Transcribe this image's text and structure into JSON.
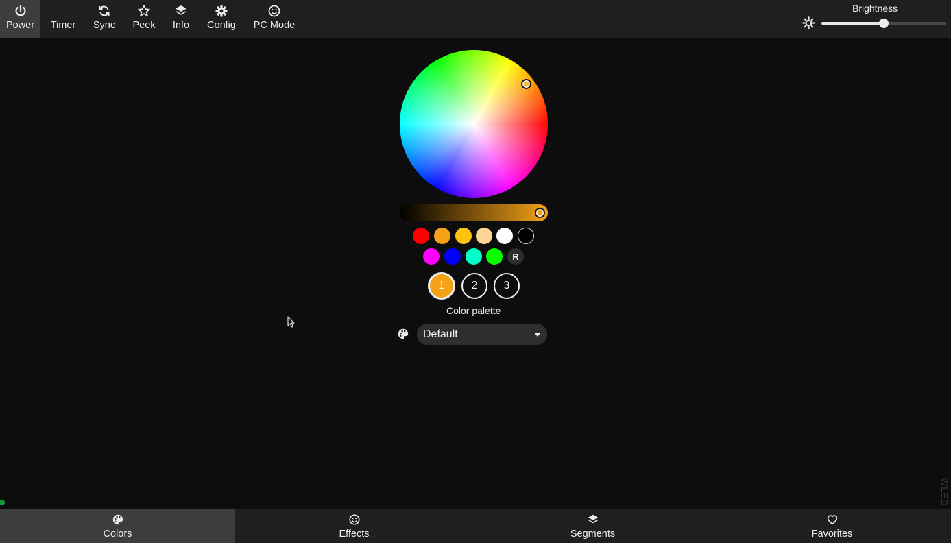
{
  "top_nav": [
    {
      "label": "Power",
      "icon": "power-icon",
      "active": true
    },
    {
      "label": "Timer",
      "icon": "moon-icon"
    },
    {
      "label": "Sync",
      "icon": "sync-icon"
    },
    {
      "label": "Peek",
      "icon": "star-icon"
    },
    {
      "label": "Info",
      "icon": "layers-icon"
    },
    {
      "label": "Config",
      "icon": "gear-icon"
    },
    {
      "label": "PC Mode",
      "icon": "smiley-icon"
    }
  ],
  "brightness": {
    "label": "Brightness",
    "value_fraction": 0.5
  },
  "color_picker": {
    "selected_color": "#f5a218",
    "value_fraction": 0.94
  },
  "quick_colors": {
    "row1": [
      "#ff0000",
      "#f5a218",
      "#ffc20e",
      "#ffd596",
      "#ffffff",
      "#000000"
    ],
    "row2": [
      "#ff00ff",
      "#0000ff",
      "#00ffc8",
      "#08ff00"
    ],
    "random_label": "R"
  },
  "color_slots": [
    {
      "label": "1",
      "selected": true
    },
    {
      "label": "2"
    },
    {
      "label": "3"
    }
  ],
  "palette": {
    "label": "Color palette",
    "selected": "Default"
  },
  "watermark": "WLED",
  "bottom_nav": [
    {
      "label": "Colors",
      "icon": "palette-icon",
      "active": true
    },
    {
      "label": "Effects",
      "icon": "smiley-icon"
    },
    {
      "label": "Segments",
      "icon": "layers-icon"
    },
    {
      "label": "Favorites",
      "icon": "heart-icon"
    }
  ],
  "colors": {
    "accent": "#f5a218",
    "bar_bg": "#1f1f1f",
    "active_bg": "#3d3d3d",
    "page_bg": "#0d0d0d"
  }
}
